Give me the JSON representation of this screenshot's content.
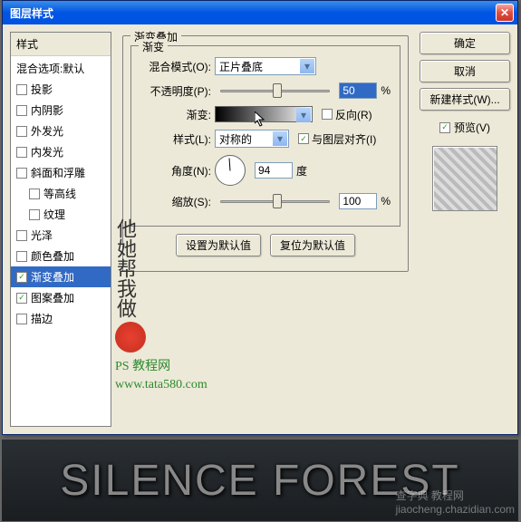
{
  "titlebar": {
    "title": "图层样式"
  },
  "left": {
    "header": "样式",
    "blending": "混合选项:默认",
    "items": [
      {
        "label": "投影",
        "checked": false
      },
      {
        "label": "内阴影",
        "checked": false
      },
      {
        "label": "外发光",
        "checked": false
      },
      {
        "label": "内发光",
        "checked": false
      },
      {
        "label": "斜面和浮雕",
        "checked": false
      },
      {
        "label": "等高线",
        "checked": false,
        "indent": true
      },
      {
        "label": "纹理",
        "checked": false,
        "indent": true
      },
      {
        "label": "光泽",
        "checked": false
      },
      {
        "label": "颜色叠加",
        "checked": false
      },
      {
        "label": "渐变叠加",
        "checked": true,
        "selected": true
      },
      {
        "label": "图案叠加",
        "checked": true
      },
      {
        "label": "描边",
        "checked": false
      }
    ]
  },
  "center": {
    "group_title": "渐变叠加",
    "inner_title": "渐变",
    "blend_mode_label": "混合模式(O):",
    "blend_mode_value": "正片叠底",
    "opacity_label": "不透明度(P):",
    "opacity_value": "50",
    "opacity_unit": "%",
    "gradient_label": "渐变:",
    "reverse_label": "反向(R)",
    "style_label": "样式(L):",
    "style_value": "对称的",
    "align_label": "与图层对齐(I)",
    "angle_label": "角度(N):",
    "angle_value": "94",
    "angle_unit": "度",
    "scale_label": "缩放(S):",
    "scale_value": "100",
    "scale_unit": "%",
    "set_default": "设置为默认值",
    "reset_default": "复位为默认值"
  },
  "right": {
    "ok": "确定",
    "cancel": "取消",
    "new_style": "新建样式(W)...",
    "preview_label": "预览(V)"
  },
  "watermark": {
    "line1": "PS 教程网",
    "line2": "www.tata580.com"
  },
  "bottom": {
    "text": "SILENCE FOREST",
    "credit1": "查字典  教程网",
    "credit2": "jiaocheng.chazidian.com"
  }
}
